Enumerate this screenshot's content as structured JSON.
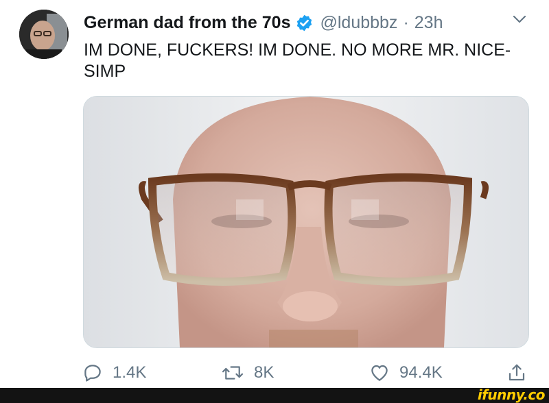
{
  "tweet": {
    "display_name": "German dad from the 70s",
    "handle": "@ldubbbz",
    "separator": "·",
    "time": "23h",
    "text": "IM DONE, FUCKERS! IM DONE. NO MORE MR. NICE-SIMP",
    "verified": true,
    "icons": {
      "avatar": "avatar-photo",
      "verified": "verified-badge-icon",
      "menu": "chevron-down-icon"
    }
  },
  "actions": {
    "reply_count": "1.4K",
    "retweet_count": "8K",
    "like_count": "94.4K",
    "icons": [
      "reply-icon",
      "retweet-icon",
      "like-icon",
      "share-icon"
    ]
  },
  "watermark": {
    "text": "ifunny.co"
  },
  "colors": {
    "text": "#14171a",
    "secondary": "#657786",
    "verified": "#1da1f2",
    "watermark": "#ffcc00",
    "banner": "#131313"
  }
}
